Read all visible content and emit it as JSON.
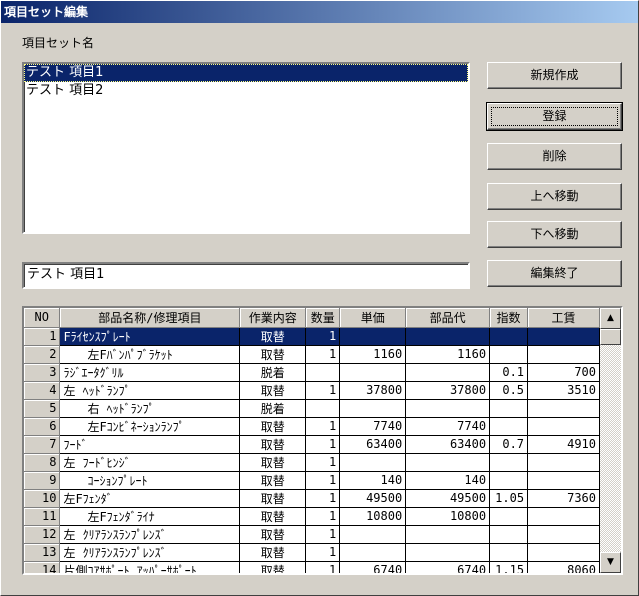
{
  "window": {
    "title": "項目セット編集"
  },
  "set_list": {
    "label": "項目セット名",
    "items": [
      {
        "label": "テスト 項目1",
        "selected": true
      },
      {
        "label": "テスト 項目2",
        "selected": false
      }
    ]
  },
  "buttons": {
    "new": "新規作成",
    "register": "登録",
    "delete": "削除",
    "move_up": "上へ移動",
    "move_down": "下へ移動",
    "finish": "編集終了"
  },
  "name_field": {
    "value": "テスト 項目1"
  },
  "grid": {
    "headers": [
      "NO",
      "部品名称/修理項目",
      "作業内容",
      "数量",
      "単価",
      "部品代",
      "指数",
      "工賃"
    ],
    "rows": [
      [
        "1",
        "Fﾗｲｾﾝｽﾌﾟﾚｰﾄ",
        "取替",
        "1",
        "",
        "",
        "",
        ""
      ],
      [
        "2",
        "　　左Fﾊﾞﾝﾊﾟﾌﾞﾗｹｯﾄ",
        "取替",
        "1",
        "1160",
        "1160",
        "",
        ""
      ],
      [
        "3",
        "ﾗｼﾞｴｰﾀｸﾞﾘﾙ",
        "脱着",
        "",
        "",
        "",
        "0.1",
        "700"
      ],
      [
        "4",
        "左 ﾍｯﾄﾞﾗﾝﾌﾟ",
        "取替",
        "1",
        "37800",
        "37800",
        "0.5",
        "3510"
      ],
      [
        "5",
        "　　右 ﾍｯﾄﾞﾗﾝﾌﾟ",
        "脱着",
        "",
        "",
        "",
        "",
        ""
      ],
      [
        "6",
        "　　左Fｺﾝﾋﾞﾈｰｼｮﾝﾗﾝﾌﾟ",
        "取替",
        "1",
        "7740",
        "7740",
        "",
        ""
      ],
      [
        "7",
        "ﾌｰﾄﾞ",
        "取替",
        "1",
        "63400",
        "63400",
        "0.7",
        "4910"
      ],
      [
        "8",
        "左 ﾌｰﾄﾞﾋﾝｼﾞ",
        "取替",
        "1",
        "",
        "",
        "",
        ""
      ],
      [
        "9",
        "　　ｺｰｼｮﾝﾌﾟﾚｰﾄ",
        "取替",
        "1",
        "140",
        "140",
        "",
        ""
      ],
      [
        "10",
        "左Fﾌｪﾝﾀﾞ",
        "取替",
        "1",
        "49500",
        "49500",
        "1.05",
        "7360"
      ],
      [
        "11",
        "　　左Fﾌｪﾝﾀﾞﾗｲﾅ",
        "取替",
        "1",
        "10800",
        "10800",
        "",
        ""
      ],
      [
        "12",
        "左 ｸﾘｱﾗﾝｽﾗﾝﾌﾟﾚﾝｽﾞ",
        "取替",
        "1",
        "",
        "",
        "",
        ""
      ],
      [
        "13",
        "左 ｸﾘｱﾗﾝｽﾗﾝﾌﾟﾚﾝｽﾞ",
        "取替",
        "1",
        "",
        "",
        "",
        ""
      ],
      [
        "14",
        "片側ｺｱｻﾎﾟｰﾄ ｱｯﾊﾟｰｻﾎﾟｰﾄ",
        "取替",
        "1",
        "6740",
        "6740",
        "1.15",
        "8060"
      ]
    ],
    "selected_row": 0
  },
  "colors": {
    "selection": "#0a246a",
    "face": "#d4d0c8"
  }
}
